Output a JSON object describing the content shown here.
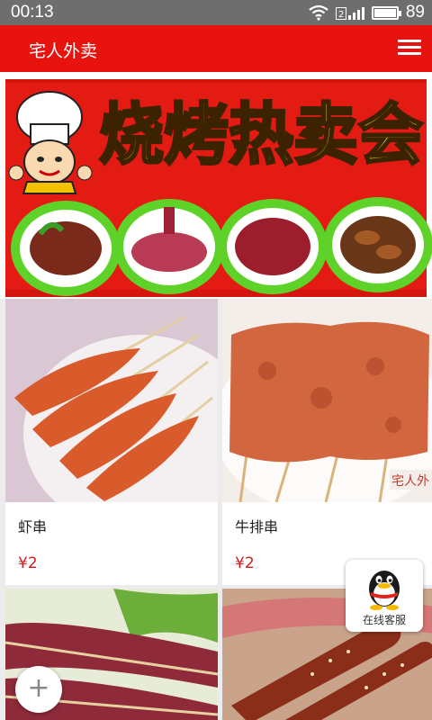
{
  "status_bar": {
    "time": "00:13",
    "battery_level": "89",
    "battery_fraction": 0.89
  },
  "app_bar": {
    "title": "宅人外卖",
    "menu_icon": "hamburger-menu-icon"
  },
  "banner": {
    "headline": "烧烤热卖会"
  },
  "products": [
    {
      "name": "虾串",
      "price": "¥2"
    },
    {
      "name": "牛排串",
      "price": "¥2"
    },
    {
      "name": "",
      "price": ""
    },
    {
      "name": "",
      "price": ""
    }
  ],
  "watermark": "宅人外",
  "customer_service": {
    "label": "在线客服",
    "icon": "qq-penguin-icon"
  },
  "fab": {
    "label": "+",
    "icon": "plus-icon"
  },
  "colors": {
    "brand_red": "#e8130f",
    "price_red": "#d31b1b",
    "status_bar": "#6e6e6e"
  }
}
